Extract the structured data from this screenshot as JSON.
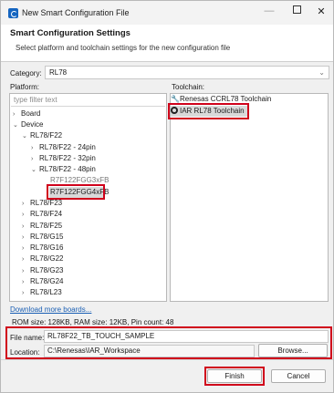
{
  "window": {
    "title": "New Smart Configuration File",
    "minimize_glyph": "—",
    "close_glyph": "✕"
  },
  "header": {
    "title": "Smart Configuration Settings",
    "description": "Select platform and toolchain settings for the new configuration file"
  },
  "category": {
    "label": "Category:",
    "value": "RL78"
  },
  "platform": {
    "label": "Platform:",
    "filter_placeholder": "type filter text",
    "tree": [
      {
        "chevron": "›",
        "label": "Board"
      },
      {
        "chevron": "⌄",
        "label": "Device"
      },
      {
        "chevron": "⌄",
        "label": "RL78/F22"
      },
      {
        "chevron": "›",
        "label": "RL78/F22 - 24pin"
      },
      {
        "chevron": "›",
        "label": "RL78/F22 - 32pin"
      },
      {
        "chevron": "⌄",
        "label": "RL78/F22 - 48pin"
      },
      {
        "chevron": "",
        "label": "R7F122FGG3xFB"
      },
      {
        "chevron": "",
        "label": "R7F122FGG4xFB"
      },
      {
        "chevron": "›",
        "label": "RL78/F23"
      },
      {
        "chevron": "›",
        "label": "RL78/F24"
      },
      {
        "chevron": "›",
        "label": "RL78/F25"
      },
      {
        "chevron": "›",
        "label": "RL78/G15"
      },
      {
        "chevron": "›",
        "label": "RL78/G16"
      },
      {
        "chevron": "›",
        "label": "RL78/G22"
      },
      {
        "chevron": "›",
        "label": "RL78/G23"
      },
      {
        "chevron": "›",
        "label": "RL78/G24"
      },
      {
        "chevron": "›",
        "label": "RL78/L23"
      }
    ]
  },
  "toolchain": {
    "label": "Toolchain:",
    "items": [
      {
        "label": "Renesas CCRL78 Toolchain",
        "icon": "wrench-icon"
      },
      {
        "label": "IAR RL78 Toolchain",
        "icon": "iar-icon"
      }
    ]
  },
  "download_link": "Download more boards...",
  "device_info": "ROM size: 128KB, RAM size: 12KB, Pin count: 48",
  "file_name": {
    "label": "File name:",
    "value": "RL78F22_TB_TOUCH_SAMPLE"
  },
  "location": {
    "label": "Location:",
    "value": "C:\\Renesas\\IAR_Workspace",
    "browse_label": "Browse..."
  },
  "buttons": {
    "finish": "Finish",
    "cancel": "Cancel"
  },
  "colors": {
    "highlight_box": "#d0021b",
    "link": "#1a5fb4",
    "selection": "#d9d9d9"
  }
}
